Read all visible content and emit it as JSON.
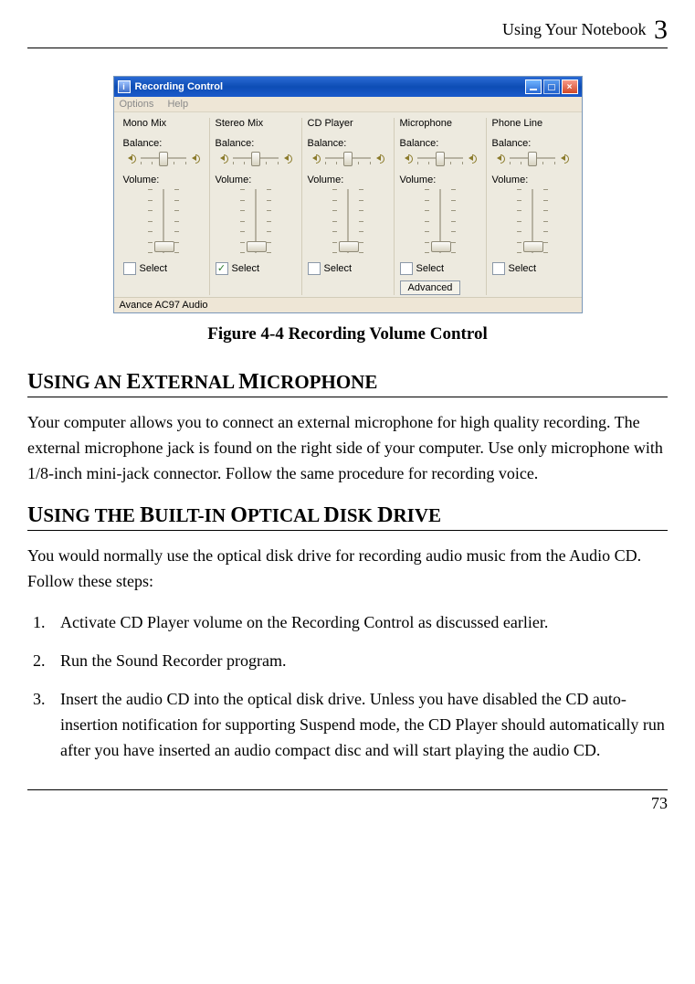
{
  "header": {
    "text": "Using Your Notebook",
    "chapter_num": "3"
  },
  "dialog": {
    "title": "Recording Control",
    "menu": {
      "options": "Options",
      "help": "Help"
    },
    "balance_label": "Balance:",
    "volume_label": "Volume:",
    "select_label": "Select",
    "advanced_label": "Advanced",
    "channels": [
      {
        "name": "Mono Mix",
        "selected": false,
        "vol_pos_pct": 88,
        "advanced": false
      },
      {
        "name": "Stereo Mix",
        "selected": true,
        "vol_pos_pct": 88,
        "advanced": false
      },
      {
        "name": "CD Player",
        "selected": false,
        "vol_pos_pct": 88,
        "advanced": false
      },
      {
        "name": "Microphone",
        "selected": false,
        "vol_pos_pct": 88,
        "advanced": true
      },
      {
        "name": "Phone Line",
        "selected": false,
        "vol_pos_pct": 88,
        "advanced": false
      }
    ],
    "status": "Avance AC97 Audio"
  },
  "figure_caption": "Figure 4-4 Recording Volume Control",
  "section1": {
    "title_words": [
      "U",
      "SING AN ",
      "E",
      "XTERNAL ",
      "M",
      "ICROPHONE"
    ],
    "body": "Your computer allows you to connect an external microphone for high quality recording. The external microphone jack is found on the right side of your computer. Use only microphone with 1/8-inch mini-jack connector. Follow the same procedure for recording voice."
  },
  "section2": {
    "title_words": [
      "U",
      "SING THE ",
      "B",
      "UILT-IN ",
      "O",
      "PTICAL ",
      "D",
      "ISK ",
      "D",
      "RIVE"
    ],
    "intro": "You would normally use the optical disk drive for recording audio music from the Audio CD. Follow these steps:",
    "steps": [
      "Activate CD Player volume on the Recording Control as discussed earlier.",
      "Run the Sound Recorder program.",
      "Insert the audio CD into the optical disk drive. Unless you have disabled the CD auto-insertion notification for supporting Suspend mode, the CD Player should automatically run after you have inserted an audio compact disc and will start playing the audio CD."
    ]
  },
  "page_number": "73"
}
